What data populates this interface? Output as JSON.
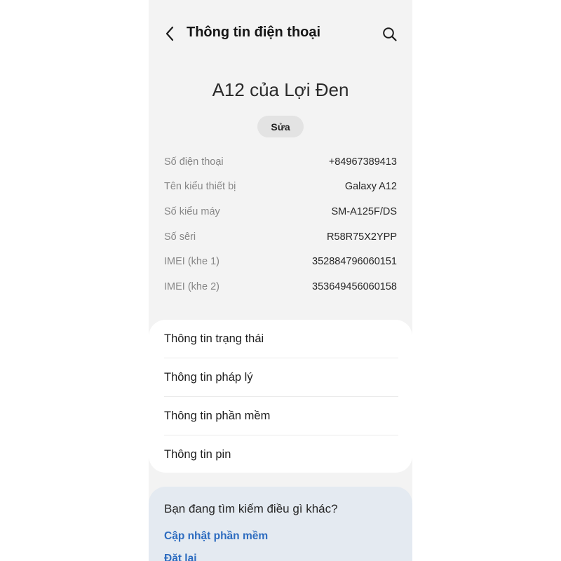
{
  "header": {
    "title": "Thông tin điện thoại",
    "back_icon": "chevron-left-icon",
    "search_icon": "search-icon"
  },
  "device": {
    "name": "A12 của Lợi Đen",
    "edit_label": "Sửa"
  },
  "info_rows": [
    {
      "label": "Số điện thoại",
      "value": "+84967389413"
    },
    {
      "label": "Tên kiểu thiết bị",
      "value": "Galaxy A12"
    },
    {
      "label": "Số kiểu máy",
      "value": "SM-A125F/DS"
    },
    {
      "label": "Số sêri",
      "value": "R58R75X2YPP"
    },
    {
      "label": "IMEI (khe 1)",
      "value": "352884796060151"
    },
    {
      "label": "IMEI (khe 2)",
      "value": "353649456060158"
    }
  ],
  "menu_items": [
    {
      "label": "Thông tin trạng thái"
    },
    {
      "label": "Thông tin pháp lý"
    },
    {
      "label": "Thông tin phần mềm"
    },
    {
      "label": "Thông tin pin"
    }
  ],
  "suggestions": {
    "title": "Bạn đang tìm kiếm điều gì khác?",
    "links": [
      {
        "label": "Cập nhật phần mềm"
      },
      {
        "label": "Đặt lại"
      }
    ]
  },
  "colors": {
    "background": "#f3f3f3",
    "card": "#ffffff",
    "suggest_card": "#e4eaf1",
    "link": "#2d6cc0"
  }
}
